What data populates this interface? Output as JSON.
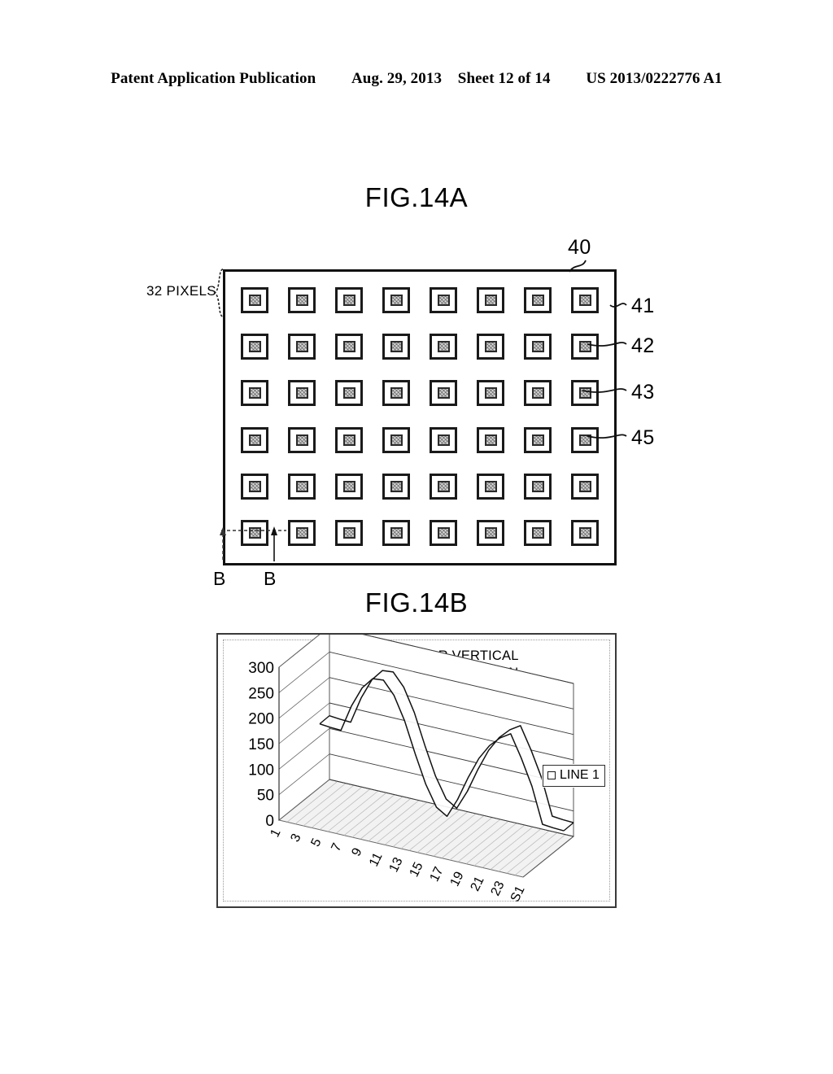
{
  "header": {
    "publication": "Patent Application Publication",
    "date": "Aug. 29, 2013",
    "sheet": "Sheet 12 of 14",
    "patent_number": "US 2013/0222776 A1"
  },
  "figures": {
    "fig_a_title": "FIG.14A",
    "fig_b_title": "FIG.14B"
  },
  "fig_a": {
    "pixels_label": "32 PIXELS",
    "ref_40": "40",
    "ref_41": "41",
    "ref_42": "42",
    "ref_43": "43",
    "ref_45": "45",
    "section_left": "B",
    "section_right": "B",
    "grid_columns": 8,
    "grid_rows": 6
  },
  "chart_data": {
    "type": "line",
    "title": "HORIZONTAL OR VERTICAL\nCENTRAL CROSS-SECTION",
    "title_line1": "HORIZONTAL OR VERTICAL",
    "title_line2": "CENTRAL CROSS-SECTION",
    "xlabel": "",
    "ylabel": "",
    "ylim": [
      0,
      300
    ],
    "yticks": [
      300,
      250,
      200,
      150,
      100,
      50,
      0
    ],
    "grid": true,
    "legend_position": "right",
    "legend": [
      "LINE 1"
    ],
    "x": [
      1,
      2,
      3,
      4,
      5,
      6,
      7,
      8,
      9,
      10,
      11,
      12,
      13,
      14,
      15,
      16,
      17,
      18,
      19,
      20,
      21,
      22,
      23,
      24
    ],
    "xtick_labels": [
      "1",
      "3",
      "5",
      "7",
      "9",
      "11",
      "13",
      "15",
      "17",
      "19",
      "21",
      "23",
      "S1"
    ],
    "series": [
      {
        "name": "LINE 1",
        "values": [
          125,
          123,
          122,
          175,
          215,
          238,
          240,
          215,
          170,
          110,
          55,
          15,
          2,
          40,
          88,
          130,
          160,
          180,
          193,
          150,
          100,
          30,
          28,
          27
        ]
      }
    ]
  }
}
